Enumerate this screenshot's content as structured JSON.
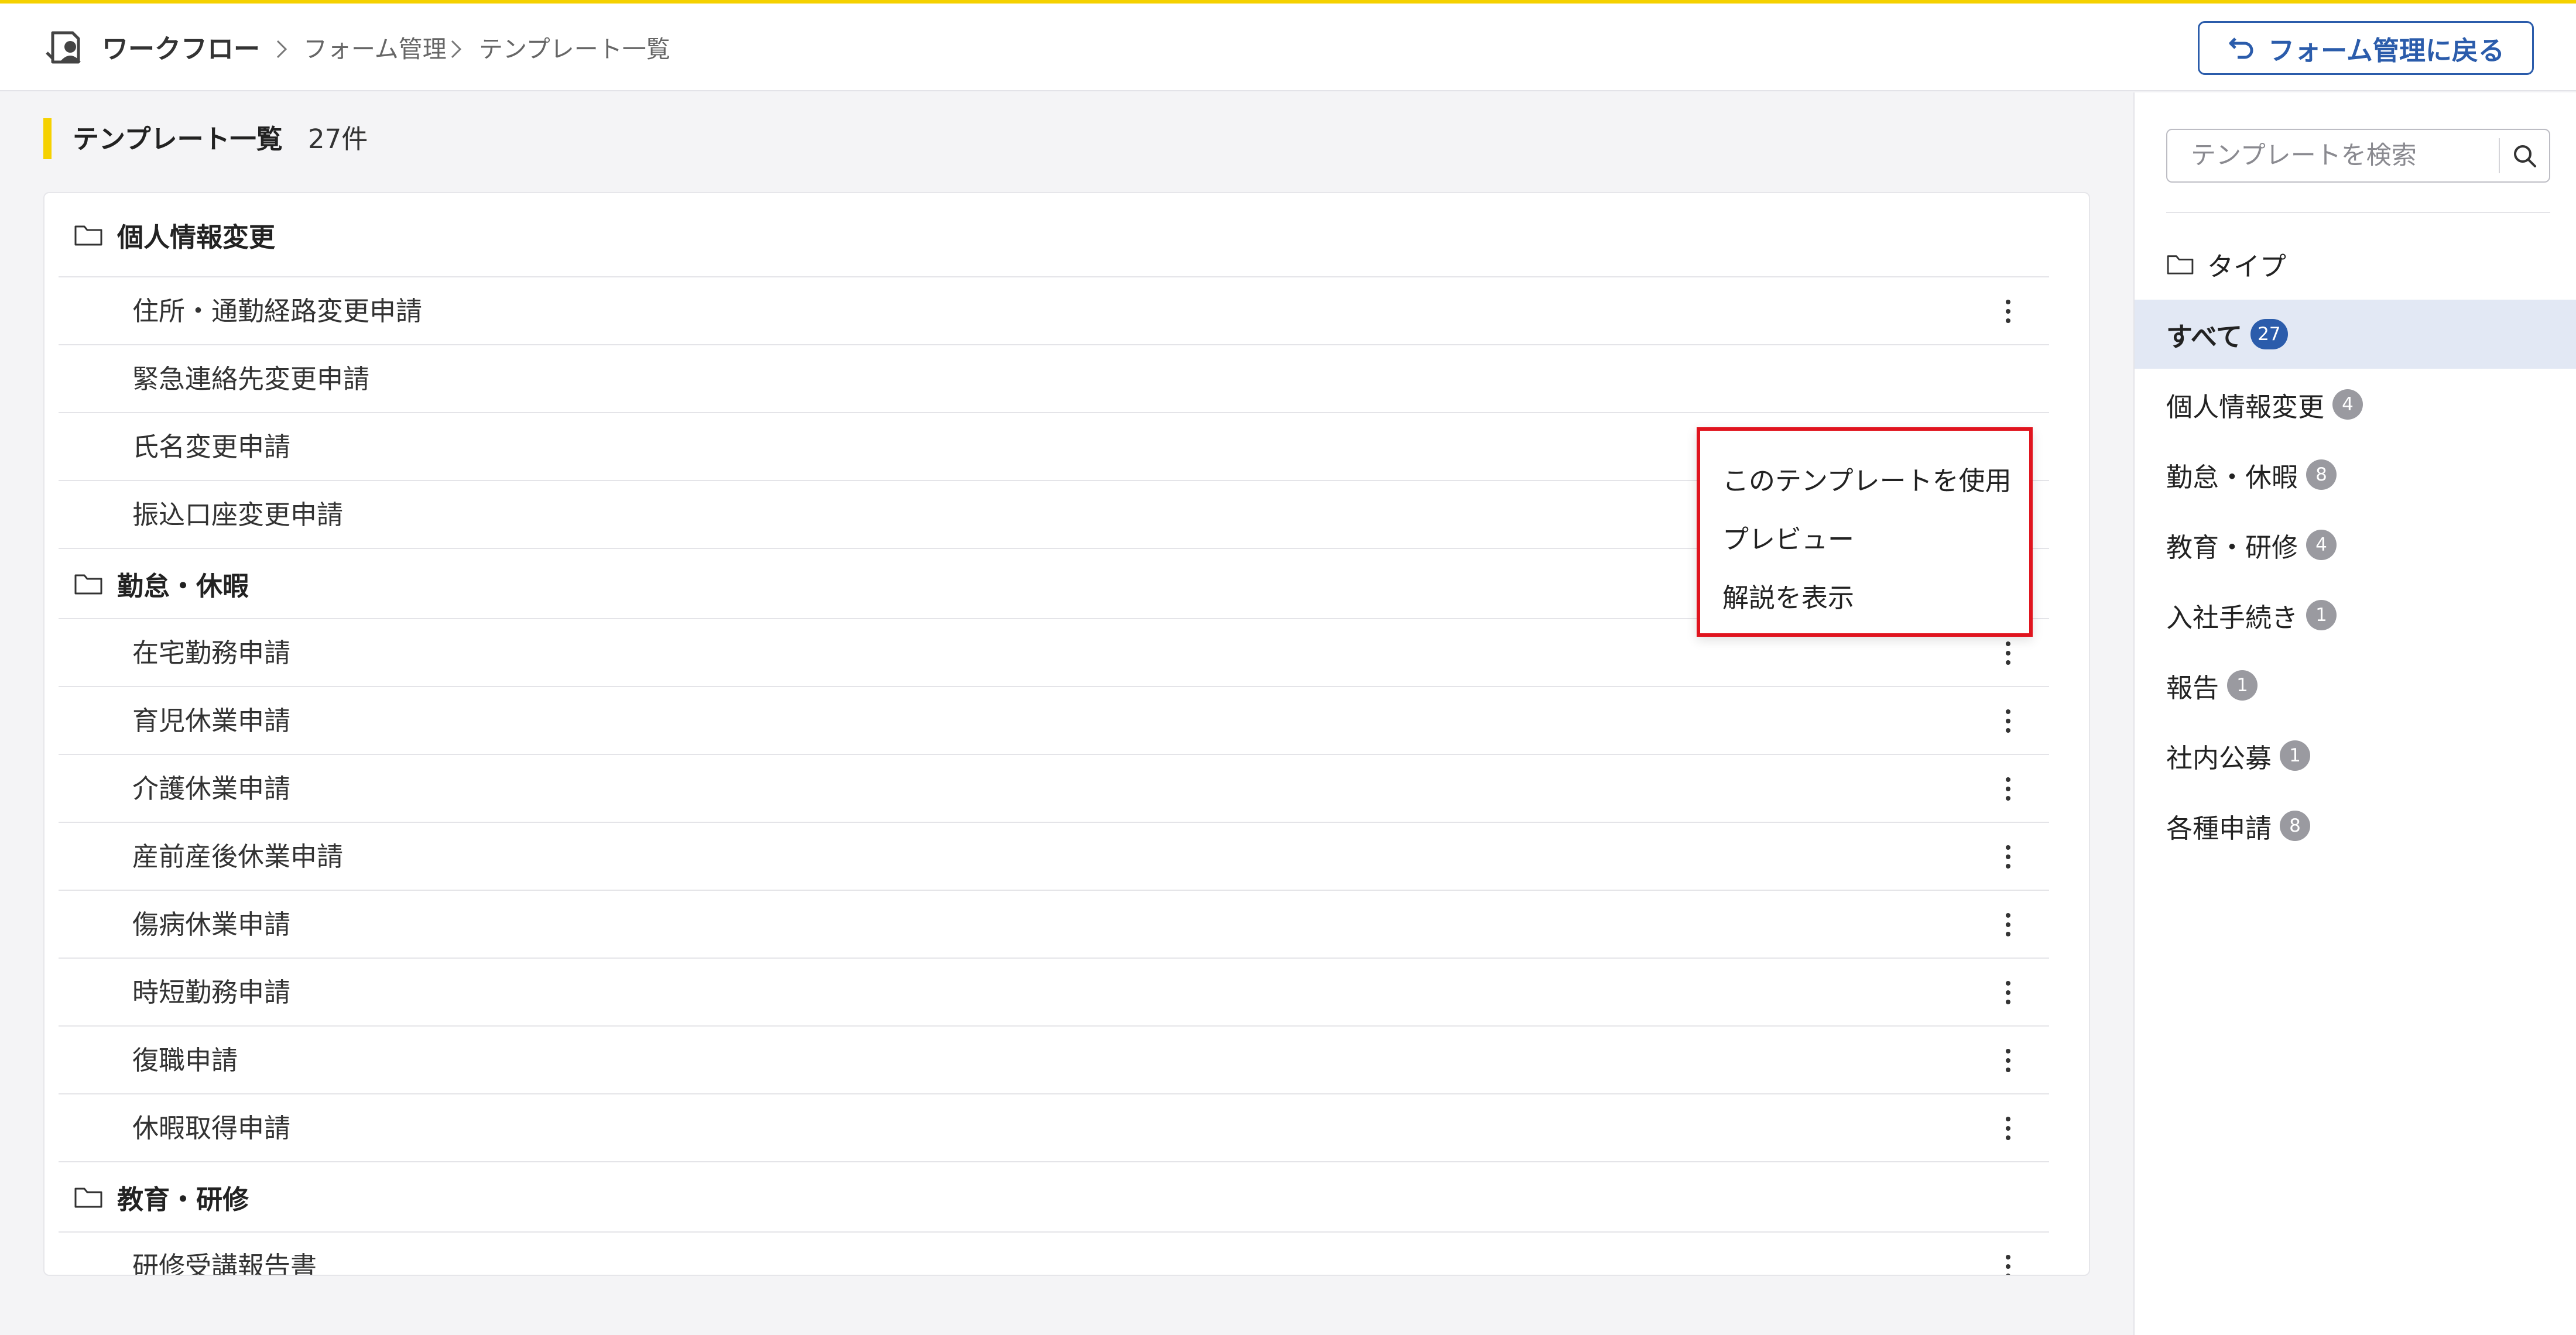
{
  "header": {
    "app_name": "ワークフロー",
    "breadcrumb": [
      "フォーム管理",
      "テンプレート一覧"
    ],
    "back_button": "フォーム管理に戻る"
  },
  "main": {
    "title": "テンプレート一覧",
    "count": "27件"
  },
  "groups": [
    {
      "label": "個人情報変更",
      "items": [
        "住所・通勤経路変更申請",
        "緊急連絡先変更申請",
        "氏名変更申請",
        "振込口座変更申請"
      ]
    },
    {
      "label": "勤怠・休暇",
      "items": [
        "在宅勤務申請",
        "育児休業申請",
        "介護休業申請",
        "産前産後休業申請",
        "傷病休業申請",
        "時短勤務申請",
        "復職申請",
        "休暇取得申請"
      ]
    },
    {
      "label": "教育・研修",
      "items": [
        "研修受講報告書"
      ]
    }
  ],
  "context_menu": {
    "items": [
      "このテンプレートを使用",
      "プレビュー",
      "解説を表示"
    ]
  },
  "sidebar": {
    "search_placeholder": "テンプレートを検索",
    "type_label": "タイプ",
    "filters": [
      {
        "label": "すべて",
        "count": "27"
      },
      {
        "label": "個人情報変更",
        "count": "4"
      },
      {
        "label": "勤怠・休暇",
        "count": "8"
      },
      {
        "label": "教育・研修",
        "count": "4"
      },
      {
        "label": "入社手続き",
        "count": "1"
      },
      {
        "label": "報告",
        "count": "1"
      },
      {
        "label": "社内公募",
        "count": "1"
      },
      {
        "label": "各種申請",
        "count": "8"
      }
    ]
  },
  "colors": {
    "accent_yellow": "#f5d100",
    "primary_blue": "#2b5cab",
    "highlight_red": "#e0141e",
    "active_bg": "#e2e8f4"
  }
}
